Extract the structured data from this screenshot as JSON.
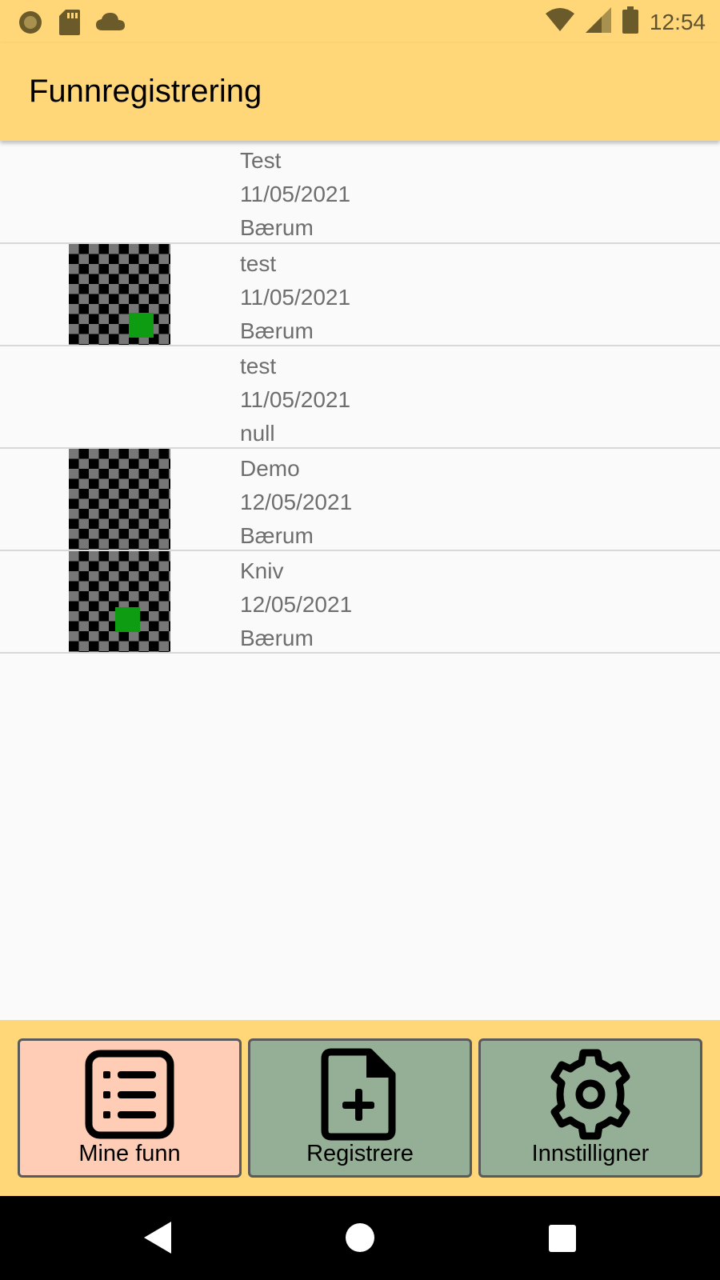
{
  "status_bar": {
    "time": "12:54",
    "icons_left": [
      "record-icon",
      "sd-card-icon",
      "cloud-icon"
    ],
    "icons_right": [
      "wifi-icon",
      "signal-icon",
      "battery-icon"
    ]
  },
  "app_bar": {
    "title": "Funnregistrering"
  },
  "finds": [
    {
      "name": "Test",
      "date": "11/05/2021",
      "location": "Bærum",
      "has_image": false
    },
    {
      "name": "test",
      "date": "11/05/2021",
      "location": "Bærum",
      "has_image": true,
      "marker": true
    },
    {
      "name": "test",
      "date": "11/05/2021",
      "location": "null",
      "has_image": false
    },
    {
      "name": "Demo",
      "date": "12/05/2021",
      "location": "Bærum",
      "has_image": true,
      "marker": false
    },
    {
      "name": "Kniv",
      "date": "12/05/2021",
      "location": "Bærum",
      "has_image": true,
      "marker": true
    }
  ],
  "bottom_nav": [
    {
      "label": "Mine funn",
      "icon": "list-icon",
      "active": true
    },
    {
      "label": "Registrere",
      "icon": "file-plus-icon",
      "active": false
    },
    {
      "label": "Innstilligner",
      "icon": "gear-icon",
      "active": false
    }
  ],
  "system_nav": [
    "back-icon",
    "home-icon",
    "recents-icon"
  ],
  "colors": {
    "app_bar": "#ffd778",
    "nav_active": "#ffcdb6",
    "nav_inactive": "#94af95",
    "thumbnail_marker": "#0e9c12"
  }
}
